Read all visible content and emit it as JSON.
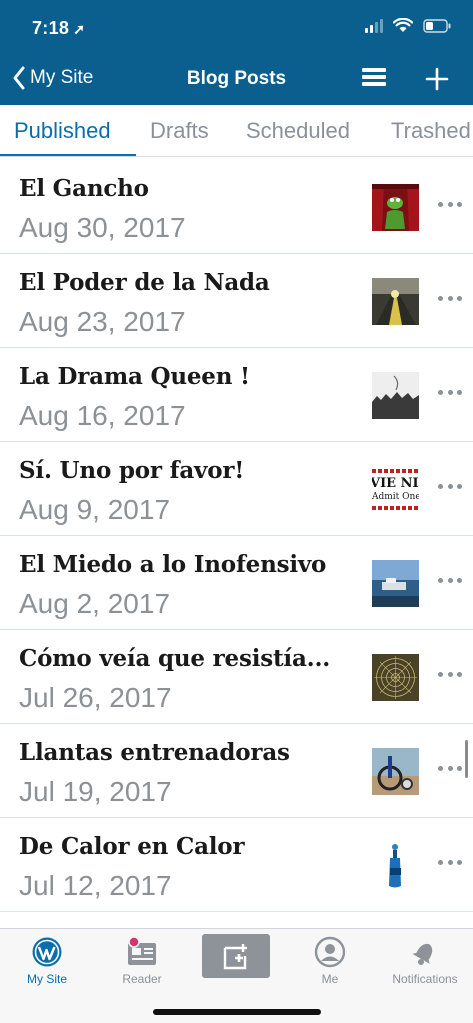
{
  "status_bar": {
    "time": "7:18"
  },
  "nav": {
    "back_label": "My Site",
    "title": "Blog Posts"
  },
  "tabs": [
    {
      "label": "Published",
      "active": true
    },
    {
      "label": "Drafts",
      "active": false
    },
    {
      "label": "Scheduled",
      "active": false
    },
    {
      "label": "Trashed",
      "active": false
    }
  ],
  "posts": [
    {
      "title": "El Gancho",
      "date": "Aug 30, 2017",
      "thumb": "kermit-theater-thumbnail"
    },
    {
      "title": "El Poder de la Nada",
      "date": "Aug 23, 2017",
      "thumb": "road-sunset-thumbnail"
    },
    {
      "title": "La Drama Queen !",
      "date": "Aug 16, 2017",
      "thumb": "bw-landscape-thumbnail"
    },
    {
      "title": "Sí. Uno por favor!",
      "date": "Aug 9, 2017",
      "thumb": "movie-ticket-thumbnail",
      "thumb_text_1": "VIE NIG",
      "thumb_text_2": "Admit One"
    },
    {
      "title": "El Miedo a lo Inofensivo",
      "date": "Aug 2, 2017",
      "thumb": "harbor-thumbnail"
    },
    {
      "title": "Cómo veía que resistía...",
      "date": "Jul 26, 2017",
      "thumb": "spiderweb-thumbnail"
    },
    {
      "title": "Llantas entrenadoras",
      "date": "Jul 19, 2017",
      "thumb": "bicycle-training-wheels-thumbnail"
    },
    {
      "title": "De Calor en Calor",
      "date": "Jul 12, 2017",
      "thumb": "water-bottle-thumbnail"
    }
  ],
  "tabbar": {
    "my_site": "My Site",
    "reader": "Reader",
    "me": "Me",
    "notifications": "Notifications"
  },
  "colors": {
    "header": "#0a5f8f",
    "accent": "#0a6eab",
    "muted": "#8a9198",
    "reader_badge": "#d8336b"
  }
}
